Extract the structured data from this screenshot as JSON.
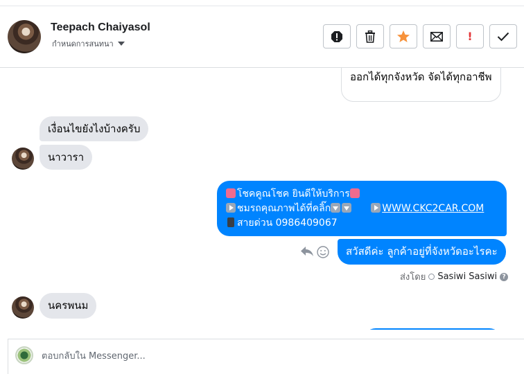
{
  "header": {
    "contact_name": "Teepach Chaiyasol",
    "label_dropdown": "กำหนดการสนทนา",
    "actions": [
      {
        "name": "spam-icon"
      },
      {
        "name": "trash-icon"
      },
      {
        "name": "star-icon",
        "color": "#f7923b"
      },
      {
        "name": "envelope-icon"
      },
      {
        "name": "follow-up-icon",
        "color": "#e4373a"
      },
      {
        "name": "check-icon"
      }
    ]
  },
  "messages": {
    "outgoing_top": "ออกได้ทุกจังหวัด จัดได้ทุกอาชีพ",
    "incoming_1": "เงื่อนไขยังไงบ้างครับ",
    "incoming_2": "นาวารา",
    "outgoing_1": {
      "line1": "โชคคูณโชค ยินดีให้บริการ",
      "line2_text": "ชมรถคุณภาพได้ที่คลิ๊ก",
      "link": "WWW.CKC2CAR.COM",
      "line3": "สายด่วน 0986409067"
    },
    "outgoing_2": "สวัสดีค่ะ ลูกค้าอยู่ที่จังหวัดอะไรคะ",
    "sent_by_label": "ส่งโดย",
    "sent_by_name": "Sasiwi Sasiwi",
    "incoming_3": "นครพนม"
  },
  "composer": {
    "placeholder": "ตอบกลับใน Messenger..."
  },
  "colors": {
    "outgoing_bubble": "#0084ff",
    "incoming_bubble": "#e4e6eb",
    "star": "#f7923b",
    "follow_up": "#e4373a"
  }
}
